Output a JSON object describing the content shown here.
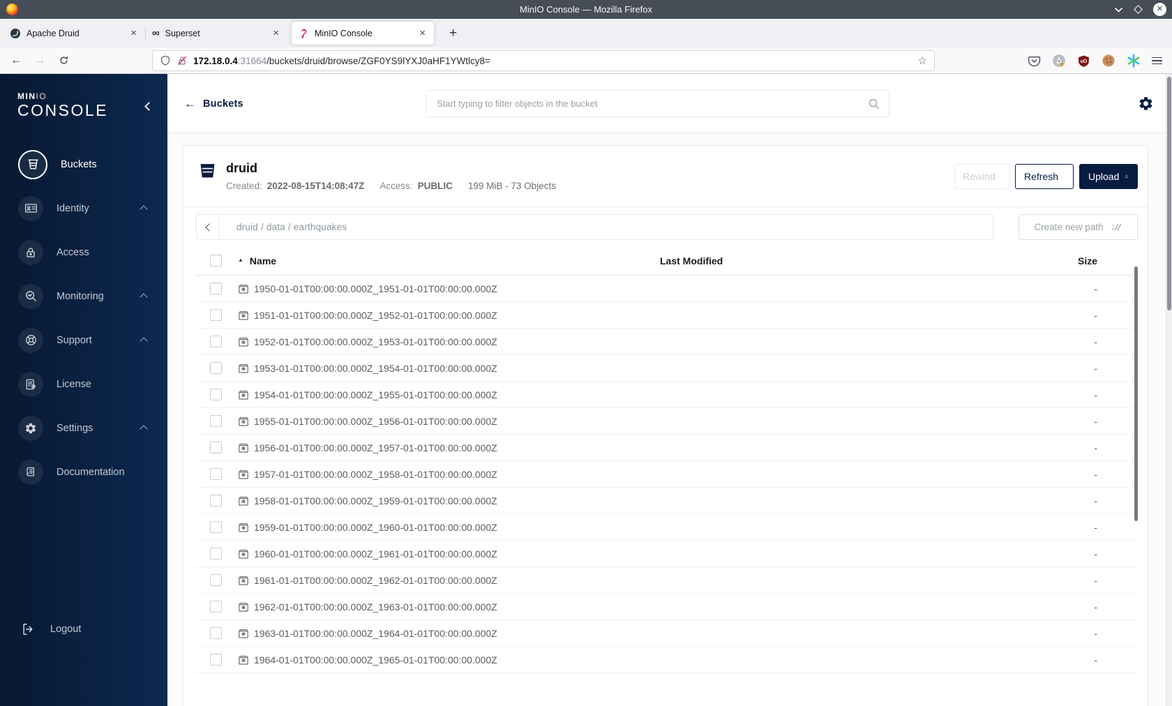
{
  "theme": {
    "navy": "#081c42",
    "minio_red": "#c9304d",
    "titlebar_gray": "#474d57"
  },
  "browser": {
    "window_title": "MinIO Console — Mozilla Firefox",
    "tabs": [
      {
        "label": "Apache Druid"
      },
      {
        "label": "Superset"
      },
      {
        "label": "MinIO Console",
        "active": true
      }
    ],
    "url": {
      "host": "172.18.0.4",
      "port": ":31664",
      "path": "/buckets/druid/browse/ZGF0YS9lYXJ0aHF1YWtlcy8="
    }
  },
  "sidebar": {
    "logo_top_bold": "MIN",
    "logo_top_light": "IO",
    "logo_main": "CONSOLE",
    "items": [
      {
        "label": "Buckets",
        "active": true,
        "expandable": false
      },
      {
        "label": "Identity",
        "expandable": true
      },
      {
        "label": "Access",
        "expandable": false
      },
      {
        "label": "Monitoring",
        "expandable": true
      },
      {
        "label": "Support",
        "expandable": true
      },
      {
        "label": "License",
        "expandable": false
      },
      {
        "label": "Settings",
        "expandable": true
      },
      {
        "label": "Documentation",
        "expandable": false
      }
    ],
    "logout_label": "Logout"
  },
  "header": {
    "back_label": "Buckets",
    "search_placeholder": "Start typing to filter objects in the bucket"
  },
  "bucket": {
    "name": "druid",
    "created_label": "Created:",
    "created_value": "2022-08-15T14:08:47Z",
    "access_label": "Access:",
    "access_value": "PUBLIC",
    "usage": "199 MiB - 73 Objects",
    "rewind_label": "Rewind",
    "refresh_label": "Refresh",
    "upload_label": "Upload"
  },
  "browse": {
    "breadcrumb": "druid / data / earthquakes",
    "create_path_label": "Create new path"
  },
  "table": {
    "headers": {
      "name": "Name",
      "last_modified": "Last Modified",
      "size": "Size"
    },
    "rows": [
      {
        "name": "1950-01-01T00:00:00.000Z_1951-01-01T00:00:00.000Z",
        "last_modified": "",
        "size": "-"
      },
      {
        "name": "1951-01-01T00:00:00.000Z_1952-01-01T00:00:00.000Z",
        "last_modified": "",
        "size": "-"
      },
      {
        "name": "1952-01-01T00:00:00.000Z_1953-01-01T00:00:00.000Z",
        "last_modified": "",
        "size": "-"
      },
      {
        "name": "1953-01-01T00:00:00.000Z_1954-01-01T00:00:00.000Z",
        "last_modified": "",
        "size": "-"
      },
      {
        "name": "1954-01-01T00:00:00.000Z_1955-01-01T00:00:00.000Z",
        "last_modified": "",
        "size": "-"
      },
      {
        "name": "1955-01-01T00:00:00.000Z_1956-01-01T00:00:00.000Z",
        "last_modified": "",
        "size": "-"
      },
      {
        "name": "1956-01-01T00:00:00.000Z_1957-01-01T00:00:00.000Z",
        "last_modified": "",
        "size": "-"
      },
      {
        "name": "1957-01-01T00:00:00.000Z_1958-01-01T00:00:00.000Z",
        "last_modified": "",
        "size": "-"
      },
      {
        "name": "1958-01-01T00:00:00.000Z_1959-01-01T00:00:00.000Z",
        "last_modified": "",
        "size": "-"
      },
      {
        "name": "1959-01-01T00:00:00.000Z_1960-01-01T00:00:00.000Z",
        "last_modified": "",
        "size": "-"
      },
      {
        "name": "1960-01-01T00:00:00.000Z_1961-01-01T00:00:00.000Z",
        "last_modified": "",
        "size": "-"
      },
      {
        "name": "1961-01-01T00:00:00.000Z_1962-01-01T00:00:00.000Z",
        "last_modified": "",
        "size": "-"
      },
      {
        "name": "1962-01-01T00:00:00.000Z_1963-01-01T00:00:00.000Z",
        "last_modified": "",
        "size": "-"
      },
      {
        "name": "1963-01-01T00:00:00.000Z_1964-01-01T00:00:00.000Z",
        "last_modified": "",
        "size": "-"
      },
      {
        "name": "1964-01-01T00:00:00.000Z_1965-01-01T00:00:00.000Z",
        "last_modified": "",
        "size": "-"
      }
    ]
  }
}
